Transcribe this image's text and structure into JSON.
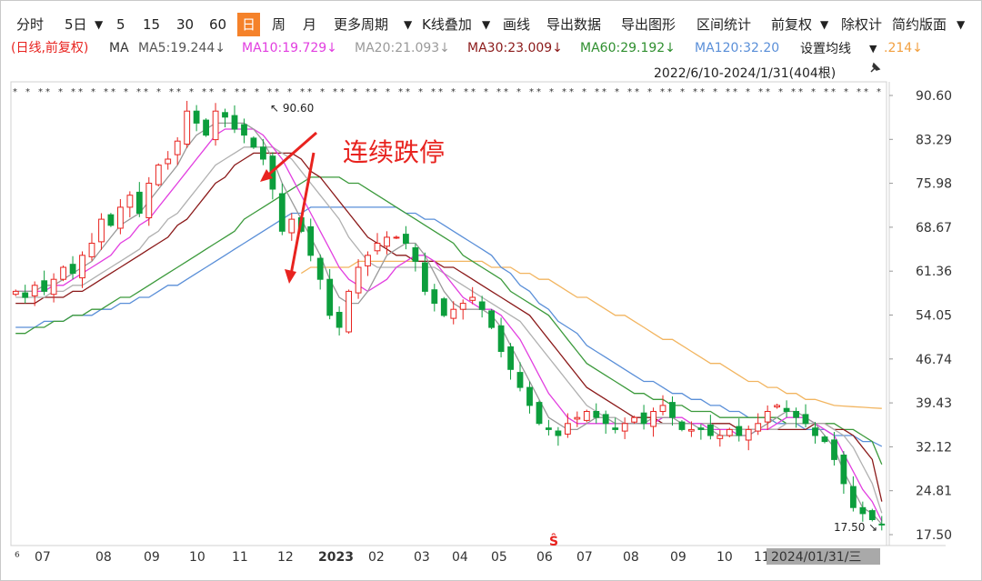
{
  "toolbar": {
    "items": [
      "分时",
      "5日",
      "▼",
      "5",
      "15",
      "30",
      "60",
      "日",
      "周",
      "月",
      "更多周期",
      "▼",
      "K线叠加",
      "▼",
      "画线",
      "导出数据",
      "导出图形",
      "区间统计",
      "前复权",
      "▼",
      "除权计",
      "简约版面",
      "▼"
    ],
    "active": "日"
  },
  "ma_legend": {
    "prefix": "(日线,前复权)",
    "ma": "MA",
    "ma5": "MA5:19.244↓",
    "ma10": "MA10:19.729↓",
    "ma20": "MA20:21.093↓",
    "ma30": "MA30:23.009↓",
    "ma60": "MA60:29.192↓",
    "ma120": "MA120:32.20",
    "ma250_tail": ".214↓",
    "set_ma": "设置均线",
    "set_ma_arrow": "▼"
  },
  "range": "2022/6/10-2024/1/31(404根)",
  "pin_icon": "pin-icon",
  "annotation": "连续跌停",
  "colors": {
    "up": "#e8231f",
    "down": "#0c9e3c",
    "ma5": "#999999",
    "ma10": "#e23fe0",
    "ma20": "#b0b0b0",
    "ma30": "#8b1a1a",
    "ma60": "#3c9a3c",
    "ma120": "#5a8fd8",
    "ma250": "#f2b560"
  },
  "chart_data": {
    "type": "candlestick",
    "y_ticks": [
      "90.60",
      "83.29",
      "75.98",
      "68.67",
      "61.36",
      "54.05",
      "46.74",
      "39.43",
      "32.12",
      "24.81",
      "17.50"
    ],
    "ylim": [
      17.5,
      90.6
    ],
    "x_ticks": [
      "07",
      "08",
      "09",
      "10",
      "11",
      "12",
      "2023",
      "02",
      "03",
      "04",
      "05",
      "06",
      "07",
      "08",
      "09",
      "10",
      "11"
    ],
    "x_cursor": "2024/01/31/三",
    "x_first": "⁶",
    "high_label": "90.60",
    "low_label": "17.50",
    "close_series": [
      58,
      57,
      59,
      58,
      60,
      62,
      61,
      64,
      66,
      70,
      69,
      72,
      74,
      71,
      76,
      79,
      80,
      83,
      88,
      86,
      84,
      88,
      87,
      85,
      84,
      82,
      80,
      75,
      68,
      70,
      68,
      64,
      60,
      54,
      52,
      58,
      62,
      64,
      66,
      67,
      67,
      66,
      63,
      58,
      56,
      54,
      55,
      56,
      57,
      55,
      52,
      48,
      45,
      42,
      39,
      36,
      35,
      34,
      36,
      37,
      38,
      37,
      36,
      35,
      36,
      37,
      36,
      38,
      39,
      37,
      35,
      35,
      35,
      34,
      34,
      35,
      34,
      35,
      36,
      38,
      39,
      38,
      37,
      36,
      34,
      33,
      30,
      26,
      22,
      21,
      20,
      19.2
    ],
    "series": [
      {
        "name": "MA5",
        "values": [
          58,
          58,
          58,
          59,
          59,
          60,
          61,
          62,
          63,
          65,
          67,
          69,
          70,
          71,
          73,
          75,
          77,
          79,
          82,
          84,
          85,
          86,
          86,
          86,
          86,
          85,
          83,
          80,
          76,
          73,
          70,
          67,
          64,
          60,
          57,
          56,
          56,
          58,
          61,
          64,
          65,
          66,
          66,
          64,
          61,
          58,
          56,
          55,
          55,
          55,
          54,
          52,
          49,
          46,
          43,
          40,
          37,
          36,
          35,
          35,
          36,
          37,
          37,
          36,
          36,
          36,
          36,
          37,
          37,
          37,
          36,
          36,
          35,
          35,
          34,
          34,
          34,
          34,
          35,
          36,
          37,
          38,
          38,
          37,
          36,
          34,
          32,
          28,
          25,
          22,
          21,
          19.24
        ]
      },
      {
        "name": "MA10",
        "values": [
          58,
          58,
          58,
          58,
          59,
          59,
          60,
          61,
          62,
          63,
          64,
          66,
          67,
          69,
          70,
          72,
          74,
          76,
          78,
          80,
          82,
          84,
          85,
          85,
          85,
          85,
          84,
          82,
          80,
          77,
          74,
          71,
          68,
          65,
          62,
          60,
          59,
          58,
          59,
          60,
          62,
          63,
          64,
          64,
          63,
          61,
          59,
          57,
          56,
          55,
          55,
          54,
          52,
          50,
          47,
          44,
          41,
          39,
          37,
          36,
          36,
          36,
          36,
          36,
          36,
          36,
          36,
          36,
          37,
          37,
          37,
          36,
          36,
          35,
          35,
          35,
          34,
          34,
          35,
          35,
          36,
          37,
          37,
          37,
          36,
          35,
          34,
          31,
          28,
          25,
          23,
          19.73
        ]
      },
      {
        "name": "MA20",
        "values": [
          57,
          57,
          57,
          57,
          58,
          58,
          59,
          59,
          60,
          61,
          62,
          63,
          64,
          65,
          67,
          68,
          70,
          71,
          73,
          75,
          77,
          79,
          80,
          81,
          82,
          82,
          82,
          82,
          81,
          80,
          78,
          76,
          74,
          72,
          70,
          67,
          65,
          63,
          62,
          62,
          62,
          62,
          62,
          62,
          62,
          61,
          60,
          59,
          58,
          57,
          56,
          55,
          54,
          53,
          51,
          49,
          47,
          45,
          43,
          41,
          39,
          38,
          37,
          37,
          36,
          36,
          36,
          36,
          36,
          36,
          36,
          36,
          36,
          36,
          35,
          35,
          35,
          35,
          35,
          35,
          35,
          36,
          36,
          36,
          36,
          36,
          35,
          34,
          32,
          29,
          26,
          21.09
        ]
      },
      {
        "name": "MA30",
        "values": [
          56,
          56,
          56,
          57,
          57,
          57,
          58,
          58,
          59,
          60,
          61,
          62,
          63,
          64,
          65,
          66,
          67,
          69,
          70,
          72,
          74,
          76,
          77,
          79,
          80,
          81,
          81,
          81,
          81,
          81,
          80,
          78,
          77,
          75,
          73,
          71,
          69,
          67,
          66,
          65,
          64,
          64,
          63,
          63,
          63,
          62,
          62,
          61,
          60,
          59,
          58,
          57,
          56,
          55,
          54,
          52,
          50,
          48,
          46,
          44,
          42,
          41,
          40,
          39,
          38,
          37,
          37,
          37,
          36,
          36,
          36,
          36,
          36,
          36,
          36,
          36,
          35,
          35,
          35,
          35,
          35,
          35,
          35,
          35,
          36,
          36,
          35,
          35,
          34,
          32,
          30,
          23.01
        ]
      },
      {
        "name": "MA60",
        "values": [
          51,
          51,
          52,
          52,
          53,
          53,
          54,
          54,
          55,
          55,
          56,
          57,
          57,
          58,
          59,
          60,
          61,
          62,
          63,
          64,
          65,
          66,
          67,
          68,
          70,
          71,
          72,
          73,
          74,
          75,
          76,
          77,
          77,
          77,
          77,
          76,
          76,
          75,
          74,
          73,
          72,
          71,
          70,
          69,
          68,
          67,
          66,
          64,
          63,
          62,
          61,
          60,
          58,
          57,
          56,
          55,
          54,
          52,
          50,
          48,
          46,
          45,
          44,
          43,
          42,
          41,
          41,
          40,
          40,
          39,
          39,
          38,
          38,
          38,
          37,
          37,
          37,
          37,
          37,
          37,
          37,
          36,
          36,
          36,
          36,
          36,
          36,
          35,
          35,
          34,
          33,
          29.19
        ]
      },
      {
        "name": "MA120",
        "values": [
          52,
          52,
          52,
          53,
          53,
          53,
          54,
          54,
          54,
          55,
          55,
          56,
          56,
          57,
          57,
          58,
          59,
          59,
          60,
          61,
          62,
          63,
          64,
          65,
          66,
          67,
          68,
          69,
          70,
          71,
          71,
          72,
          72,
          72,
          72,
          72,
          72,
          72,
          72,
          72,
          72,
          71,
          71,
          70,
          70,
          69,
          68,
          67,
          66,
          65,
          64,
          62,
          61,
          59,
          58,
          56,
          55,
          53,
          52,
          51,
          49,
          48,
          47,
          46,
          45,
          44,
          43,
          43,
          42,
          41,
          41,
          40,
          40,
          39,
          39,
          38,
          38,
          37,
          37,
          37,
          36,
          36,
          36,
          35,
          35,
          35,
          34,
          34,
          34,
          33,
          33,
          32.2
        ]
      },
      {
        "name": "MA250",
        "values": [
          null,
          null,
          null,
          null,
          null,
          null,
          null,
          null,
          null,
          null,
          null,
          null,
          null,
          null,
          null,
          null,
          null,
          null,
          null,
          null,
          null,
          null,
          null,
          null,
          null,
          null,
          null,
          null,
          null,
          null,
          61,
          62,
          62,
          62,
          62,
          62,
          63,
          63,
          63,
          63,
          63,
          63,
          63,
          63,
          63,
          63,
          63,
          63,
          63,
          63,
          62,
          62,
          62,
          61,
          61,
          60,
          60,
          59,
          58,
          57,
          57,
          56,
          55,
          54,
          54,
          53,
          52,
          51,
          50,
          50,
          49,
          48,
          47,
          46,
          46,
          45,
          44,
          43,
          43,
          42,
          42,
          41,
          41,
          40,
          40,
          39.5,
          39,
          38.9,
          38.8,
          38.7,
          38.6,
          38.5
        ]
      }
    ]
  }
}
